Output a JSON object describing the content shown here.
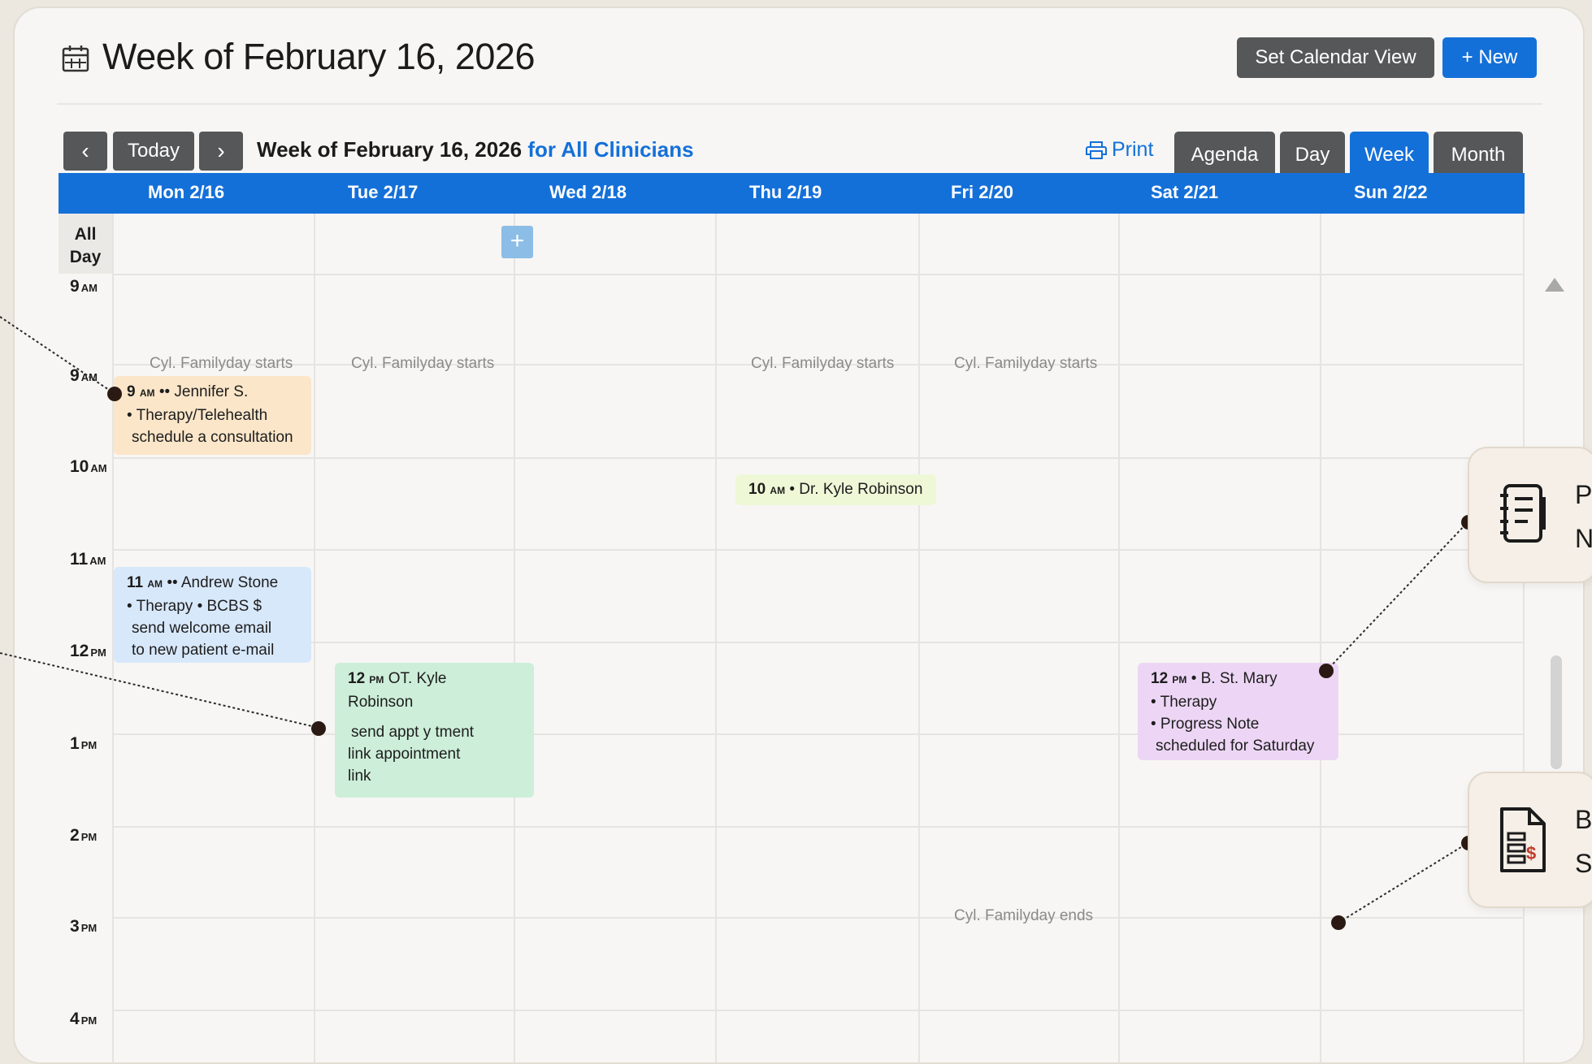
{
  "header": {
    "title": "Week of February 16, 2026",
    "set_view_label": "Set Calendar View",
    "new_label": "+ New"
  },
  "toolbar": {
    "today_label": "Today",
    "week_title": "Week of February 16, 2026",
    "clinicians_label": "for All Clinicians",
    "print_label": "Print",
    "views": [
      "Agenda",
      "Day",
      "Week",
      "Month"
    ],
    "active_view": "Week"
  },
  "days": [
    "Mon 2/16",
    "Tue 2/17",
    "Wed 2/18",
    "Thu 2/19",
    "Fri 2/20",
    "Sat 2/21",
    "Sun 2/22"
  ],
  "allday_label_1": "All",
  "allday_label_2": "Day",
  "times": [
    {
      "num": "9",
      "ap": "AM"
    },
    {
      "num": "9",
      "ap": "AM"
    },
    {
      "num": "10",
      "ap": "AM"
    },
    {
      "num": "11",
      "ap": "AM"
    },
    {
      "num": "12",
      "ap": "PM"
    },
    {
      "num": "1",
      "ap": "PM"
    },
    {
      "num": "2",
      "ap": "PM"
    },
    {
      "num": "3",
      "ap": "PM"
    },
    {
      "num": "4",
      "ap": "PM"
    }
  ],
  "notes": {
    "familyday_starts": "Cyl. Familyday starts",
    "familyday_ends": "Cyl. Familyday ends"
  },
  "events": {
    "jennifer": {
      "time": "9",
      "ap": "AM",
      "title": "•• Jennifer S.",
      "line2": "• Therapy/Telehealth",
      "line3": "schedule a consultation"
    },
    "kyle_thu": {
      "time": "10",
      "ap": "AM",
      "title": "• Dr. Kyle Robinson"
    },
    "andrew": {
      "time": "11",
      "ap": "AM",
      "title": "•• Andrew Stone",
      "line2": "• Therapy • BCBS $",
      "line3": "send welcome email",
      "line4": "to new patient e-mail"
    },
    "ot": {
      "time": "12",
      "ap": "PM",
      "title": "OT. Kyle",
      "line2": "Robinson",
      "line3": "send appt y tment",
      "line4": "link appointment",
      "line5": "link"
    },
    "stmary": {
      "time": "12",
      "ap": "PM",
      "title": "• B. St. Mary",
      "line2": "• Therapy",
      "line3": "• Progress Note",
      "line4": "scheduled for Saturday"
    }
  },
  "side_cards": {
    "card1": {
      "line1": "P",
      "line2": "N"
    },
    "card2": {
      "line1": "B",
      "line2": "S"
    }
  },
  "colors": {
    "accent": "#1470d9",
    "button_dark": "#555758",
    "event_orange": "#fbe6c9",
    "event_blue": "#d8e8fb",
    "event_green": "#cdeed9",
    "event_lime": "#eef8d7",
    "event_purple": "#edd6f5"
  }
}
